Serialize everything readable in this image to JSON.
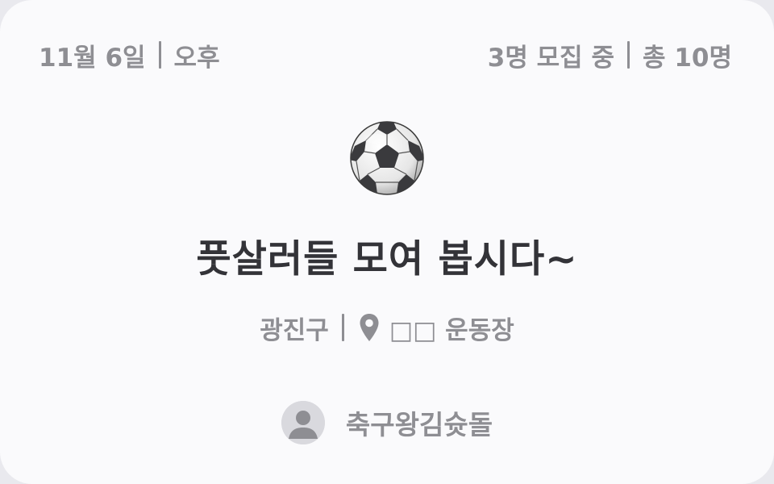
{
  "post": {
    "date": "11월 6일",
    "time_of_day": "오후",
    "recruiting": "3명 모집 중",
    "total": "총 10명",
    "sport_icon": "soccer-ball-icon",
    "title": "풋살러들 모여 봅시다~",
    "district": "광진구",
    "venue_icon": "location-pin-icon",
    "venue": "□□ 운동장",
    "author_name": "축구왕김슛돌",
    "author_avatar_icon": "person-avatar-icon"
  },
  "colors": {
    "card_background": "#fafafc",
    "muted_text": "#8e8e93",
    "title_text": "#333338",
    "avatar_background": "#d9d9de"
  }
}
